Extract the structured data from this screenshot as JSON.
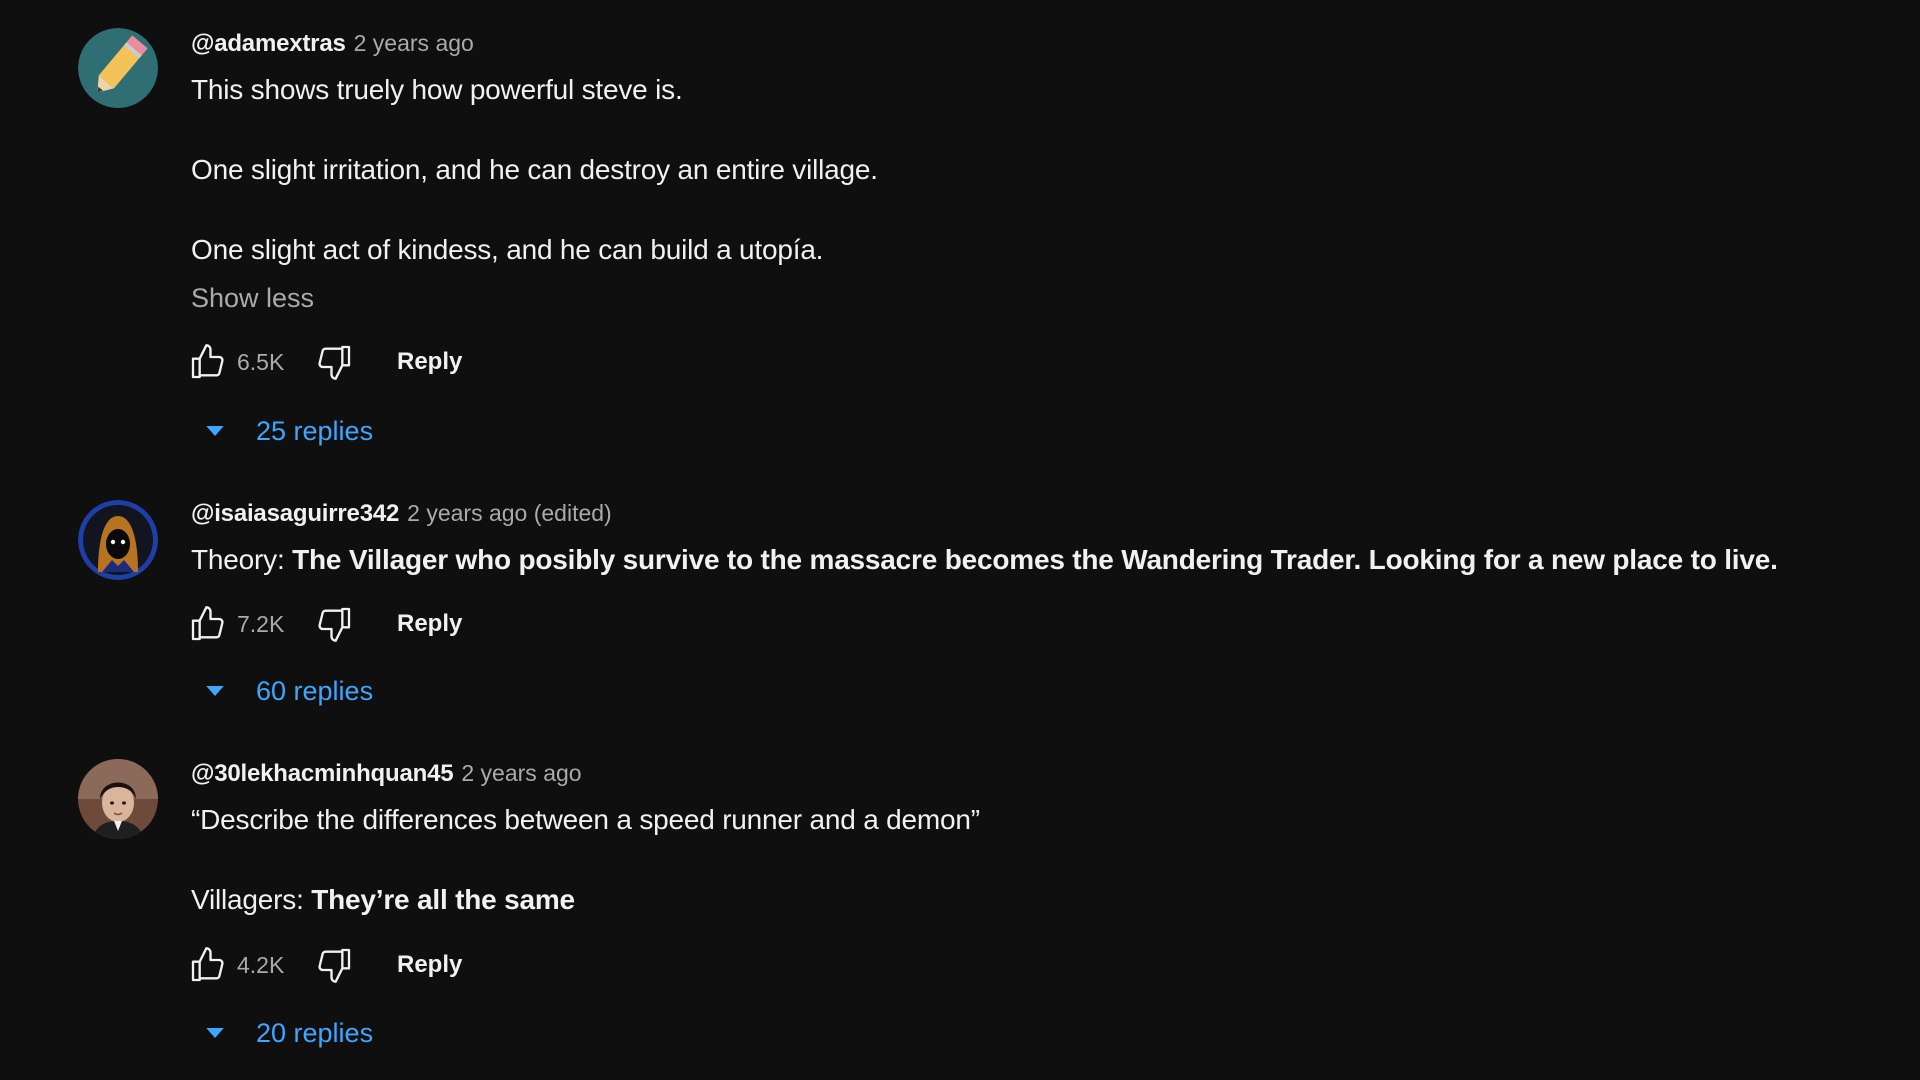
{
  "comments": [
    {
      "author": "@adamextras",
      "time": "2 years ago",
      "lines": [
        "This shows truely how powerful steve is.",
        "One slight irritation, and he can destroy an entire village.",
        "One slight act of kindess, and he can build a utopía."
      ],
      "show_less": "Show less",
      "likes": "6.5K",
      "reply_label": "Reply",
      "replies_label": "25 replies"
    },
    {
      "author": "@isaiasaguirre342",
      "time": "2 years ago (edited)",
      "theory_prefix": "Theory: ",
      "theory_bold": "The Villager who posibly survive to the massacre becomes the Wandering Trader. Looking for a new place to live.",
      "likes": "7.2K",
      "reply_label": "Reply",
      "replies_label": "60 replies"
    },
    {
      "author": "@30lekhacminhquan45",
      "time": "2 years ago",
      "line1": "“Describe the differences between a speed runner and a demon”",
      "line2_prefix": "Villagers: ",
      "line2_bold": "They’re all the same",
      "likes": "4.2K",
      "reply_label": "Reply",
      "replies_label": "20 replies"
    }
  ],
  "icons": {
    "like": "thumbs-up-icon",
    "dislike": "thumbs-down-icon",
    "expand": "caret-down-icon"
  },
  "colors": {
    "background": "#0f0f0f",
    "text": "#f1f1f1",
    "secondary_text": "#aaaaaa",
    "link_blue": "#3ea6ff"
  }
}
